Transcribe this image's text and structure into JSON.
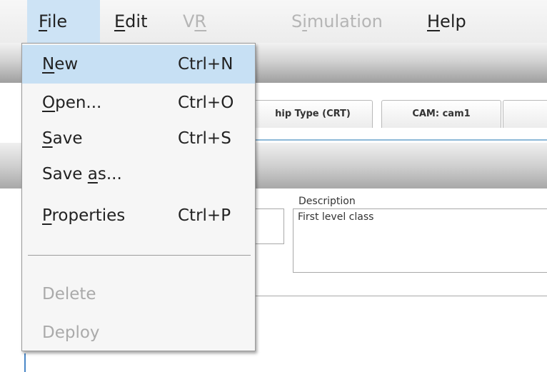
{
  "menubar": {
    "items": [
      {
        "pre": "",
        "u": "F",
        "post": "ile"
      },
      {
        "pre": "",
        "u": "E",
        "post": "dit"
      },
      {
        "pre": "V",
        "u": "R",
        "post": ""
      },
      {
        "pre": "S",
        "u": "i",
        "post": "mulation"
      },
      {
        "pre": "",
        "u": "H",
        "post": "elp"
      }
    ]
  },
  "file_menu": {
    "items": [
      {
        "pre": "",
        "u": "N",
        "post": "ew",
        "shortcut": "Ctrl+N"
      },
      {
        "pre": "",
        "u": "O",
        "post": "pen...",
        "shortcut": "Ctrl+O"
      },
      {
        "pre": "",
        "u": "S",
        "post": "ave",
        "shortcut": "Ctrl+S"
      },
      {
        "pre": "Save ",
        "u": "a",
        "post": "s...",
        "shortcut": ""
      },
      {
        "pre": "",
        "u": "P",
        "post": "roperties",
        "shortcut": "Ctrl+P"
      },
      {
        "label": "Delete"
      },
      {
        "label": "Deploy"
      }
    ]
  },
  "tabs": [
    {
      "label": "hip Type (CRT)"
    },
    {
      "label": "CAM: cam1"
    }
  ],
  "form": {
    "description_label": "Description",
    "description_value": "First level class"
  }
}
